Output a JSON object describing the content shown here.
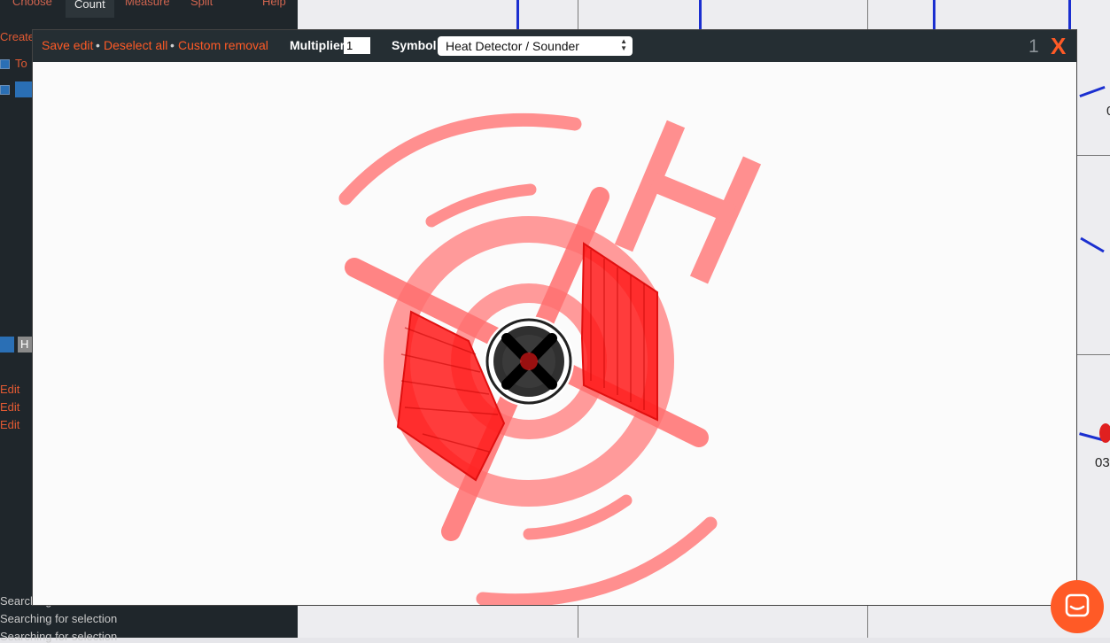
{
  "background_app": {
    "tabs": [
      "Choose",
      "Count",
      "Measure",
      "Split",
      "Help"
    ],
    "active_tab": "Count",
    "sidebar_fragments": [
      "Create",
      "To",
      "H",
      "Edit",
      "Edit",
      "Edit"
    ],
    "status_lines": [
      "Searching for selection",
      "Searching for selection",
      "Searching for selection"
    ],
    "canvas_labels": [
      "0",
      "03"
    ]
  },
  "toolbar": {
    "save_edit": "Save edit",
    "deselect_all": "Deselect all",
    "custom_removal": "Custom removal",
    "separator": "•",
    "multiplier_label": "Multiplier",
    "multiplier_value": "1",
    "symbol_label": "Symbol",
    "symbol_value": "Heat Detector / Sounder",
    "page_number": "1",
    "close_label": "X"
  },
  "symbol": {
    "letter": "H"
  },
  "colors": {
    "accent": "#ff5a26",
    "toolbar_bg": "#252e33",
    "symbol_light": "#ff8f8f",
    "symbol_strong": "#ff1a1a"
  }
}
